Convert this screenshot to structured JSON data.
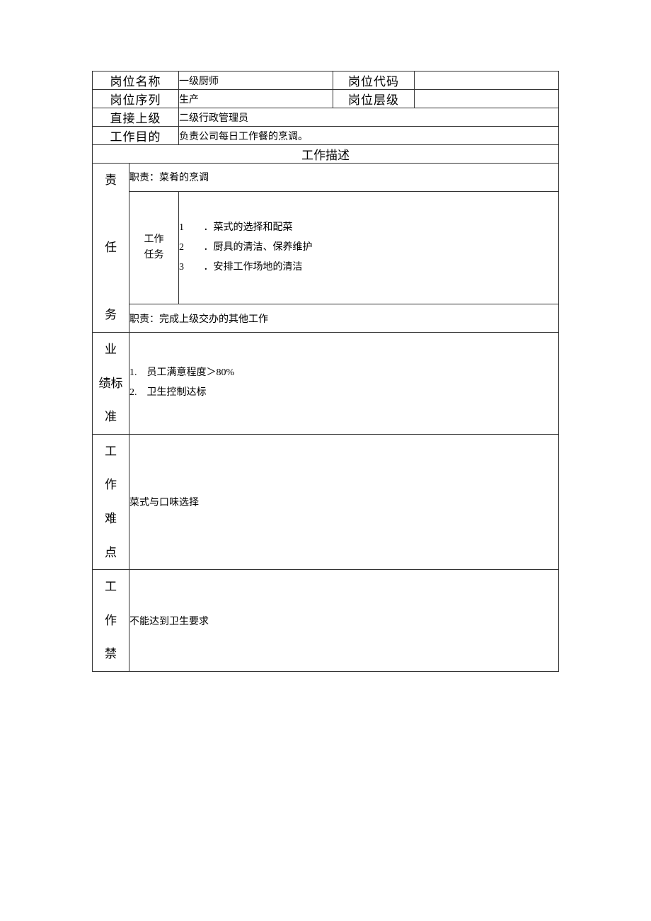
{
  "header": {
    "position_name_label": "岗位名称",
    "position_name_value": "一级厨师",
    "position_code_label": "岗位代码",
    "position_code_value": "",
    "position_series_label": "岗位序列",
    "position_series_value": "生产",
    "position_level_label": "岗位层级",
    "position_level_value": "",
    "supervisor_label": "直接上级",
    "supervisor_value": "二级行政管理员",
    "purpose_label": "工作目的",
    "purpose_value": "负责公司每日工作餐的烹调。"
  },
  "section_title": "工作描述",
  "responsibility": {
    "label": "责 任 务",
    "duty1": "职责：菜肴的烹调",
    "task_label_line1": "工作",
    "task_label_line2": "任务",
    "tasks": {
      "n1": "1",
      "t1": "．菜式的选择和配菜",
      "n2": "2",
      "t2": "．厨具的清洁、保养维护",
      "n3": "3",
      "t3": "．安排工作场地的清洁"
    },
    "duty2": "职责：完成上级交办的其他工作"
  },
  "performance": {
    "label": "业 绩标 准",
    "line1_num": "1.",
    "line1_text": "员工满意程度＞80%",
    "line2_num": "2.",
    "line2_text": "卫生控制达标"
  },
  "difficulty": {
    "label": "工 作 难 点",
    "value": "菜式与口味选择"
  },
  "forbidden": {
    "label": "工 作 禁",
    "value": "不能达到卫生要求"
  }
}
